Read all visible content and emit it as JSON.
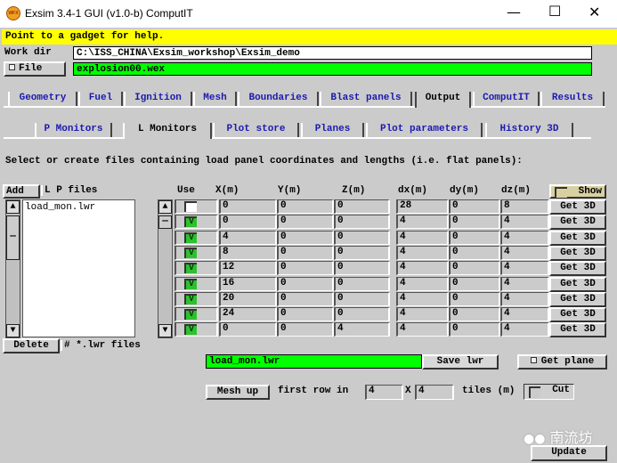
{
  "window": {
    "title": "Exsim 3.4-1 GUI (v1.0-b) ComputIT",
    "logo_text": "WFX"
  },
  "help_text": "Point to a gadget for help.",
  "workdir": {
    "label": "Work dir",
    "value": "C:\\ISS_CHINA\\Exsim_workshop\\Exsim_demo"
  },
  "file": {
    "button": "File",
    "value": "explosion00.wex"
  },
  "tabs": [
    "Geometry",
    "Fuel",
    "Ignition",
    "Mesh",
    "Boundaries",
    "Blast panels",
    "Output",
    "ComputIT",
    "Results"
  ],
  "subtabs": [
    "P Monitors",
    "L Monitors",
    "Plot store",
    "Planes",
    "Plot parameters",
    "History 3D"
  ],
  "instruction": "Select or create files containing load panel coordinates and lengths (i.e. flat panels):",
  "files": {
    "add": "Add",
    "label": "L P files",
    "items": [
      "load_mon.lwr"
    ],
    "delete": "Delete",
    "count_label": "# *.lwr files"
  },
  "table": {
    "headers": [
      "Use",
      "X(m)",
      "Y(m)",
      "Z(m)",
      "dx(m)",
      "dy(m)",
      "dz(m)"
    ],
    "show": "Show",
    "get3d": "Get 3D",
    "rows": [
      {
        "use": false,
        "x": "0",
        "y": "0",
        "z": "0",
        "dx": "28",
        "dy": "0",
        "dz": "8"
      },
      {
        "use": true,
        "x": "0",
        "y": "0",
        "z": "0",
        "dx": "4",
        "dy": "0",
        "dz": "4"
      },
      {
        "use": true,
        "x": "4",
        "y": "0",
        "z": "0",
        "dx": "4",
        "dy": "0",
        "dz": "4"
      },
      {
        "use": true,
        "x": "8",
        "y": "0",
        "z": "0",
        "dx": "4",
        "dy": "0",
        "dz": "4"
      },
      {
        "use": true,
        "x": "12",
        "y": "0",
        "z": "0",
        "dx": "4",
        "dy": "0",
        "dz": "4"
      },
      {
        "use": true,
        "x": "16",
        "y": "0",
        "z": "0",
        "dx": "4",
        "dy": "0",
        "dz": "4"
      },
      {
        "use": true,
        "x": "20",
        "y": "0",
        "z": "0",
        "dx": "4",
        "dy": "0",
        "dz": "4"
      },
      {
        "use": true,
        "x": "24",
        "y": "0",
        "z": "0",
        "dx": "4",
        "dy": "0",
        "dz": "4"
      },
      {
        "use": true,
        "x": "0",
        "y": "0",
        "z": "4",
        "dx": "4",
        "dy": "0",
        "dz": "4"
      }
    ]
  },
  "save": {
    "filename": "load_mon.lwr",
    "button": "Save lwr",
    "get_plane": "Get plane"
  },
  "mesh": {
    "button": "Mesh up",
    "label": "first row in",
    "a": "4",
    "x": "X",
    "b": "4",
    "tiles": "tiles (m)",
    "cut": "Cut"
  },
  "watermark": "南流坊",
  "update": "Update"
}
